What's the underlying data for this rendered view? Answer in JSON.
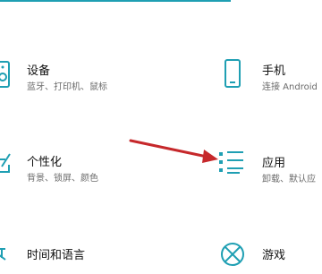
{
  "colors": {
    "accent": "#1f9fb3",
    "arrow": "#c6282b"
  },
  "tiles": [
    {
      "title": "设备",
      "subtitle": "蓝牙、打印机、鼠标",
      "icon": "devices-icon"
    },
    {
      "title": "手机",
      "subtitle": "连接 Android",
      "icon": "phone-icon"
    },
    {
      "title": "个性化",
      "subtitle": "背景、锁屏、颜色",
      "icon": "personalization-icon"
    },
    {
      "title": "应用",
      "subtitle": "卸载、默认应",
      "icon": "apps-icon"
    },
    {
      "title": "时间和语言",
      "subtitle": "",
      "icon": "time-language-icon"
    },
    {
      "title": "游戏",
      "subtitle": "",
      "icon": "xbox-icon"
    }
  ]
}
